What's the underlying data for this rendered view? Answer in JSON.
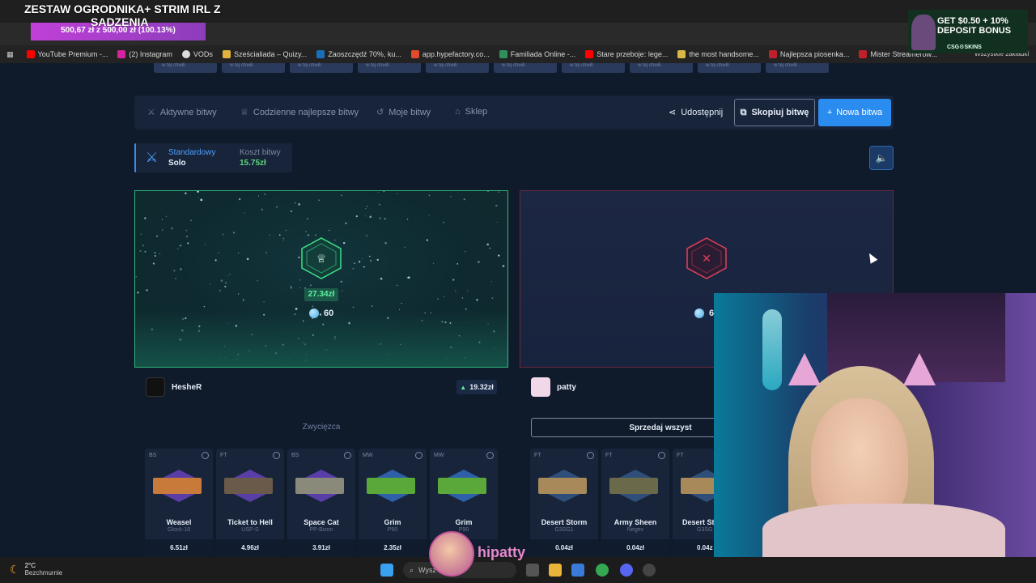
{
  "stream_overlay": {
    "title_line1": "ZESTAW OGRODNIKA+ STRIM IRL Z",
    "title_line2": "SADZENIA",
    "goal_text": "500,67 zł z 500,00 zł (100.13%)",
    "goal_progress_percent": 100
  },
  "browser": {
    "url": "19ab72-1b3c-4818-9262-5eedb91a6f1d",
    "bookmarks": [
      {
        "label": "YouTube Premium -...",
        "icon": "youtube-icon",
        "color": "#ff0000"
      },
      {
        "label": "(2) Instagram",
        "icon": "instagram-icon",
        "color": "#d6249f"
      },
      {
        "label": "VODs",
        "icon": "globe-icon",
        "color": "#dddddd"
      },
      {
        "label": "Sześcialiada – Quizy...",
        "icon": "quiz-icon",
        "color": "#e2b33c"
      },
      {
        "label": "Zaoszczędź 70%, ku...",
        "icon": "steam-icon",
        "color": "#1b6fb8"
      },
      {
        "label": "app.hypefactory.co...",
        "icon": "hype-icon",
        "color": "#e24a2c"
      },
      {
        "label": "Familiada Online -...",
        "icon": "familiada-icon",
        "color": "#2f8f5b"
      },
      {
        "label": "Stare przeboje: lege...",
        "icon": "youtube-icon",
        "color": "#ff0000"
      },
      {
        "label": "the most handsome...",
        "icon": "bookmark-icon",
        "color": "#d9b945"
      },
      {
        "label": "Najlepsza piosenka...",
        "icon": "u-icon",
        "color": "#c0202a"
      },
      {
        "label": "Mister Streamerów...",
        "icon": "u-icon",
        "color": "#c0202a"
      }
    ],
    "all_bookmarks_label": "Wszystkie zakładki"
  },
  "promo": {
    "text": "GET $0.50 + 10% DEPOSIT BONUS",
    "brand": "CSG⚙SKINS"
  },
  "top_strip_label": "w tej chwili",
  "nav": {
    "items": [
      {
        "label": "Aktywne bitwy",
        "icon": "swords-icon"
      },
      {
        "label": "Codzienne najlepsze bitwy",
        "icon": "trophy-icon"
      },
      {
        "label": "Moje bitwy",
        "icon": "history-icon"
      },
      {
        "label": "Sklep",
        "icon": "shop-icon"
      }
    ],
    "share_label": "Udostępnij",
    "copy_label": "Skopiuj bitwę",
    "new_label": "Nowa bitwa"
  },
  "battle_mode": {
    "type_label": "Standardowy",
    "mode_label": "Solo",
    "cost_label": "Koszt bitwy",
    "cost_value": "15.75zł"
  },
  "left_panel": {
    "win_value": "27.34zł",
    "tokens": "60"
  },
  "right_panel": {
    "tokens": "6"
  },
  "player_left": {
    "name": "HesheR",
    "earnings": "19.32zł",
    "status": "Zwycięzca"
  },
  "player_right": {
    "name": "patty",
    "sell_label": "Sprzedaj wszyst"
  },
  "left_items": [
    {
      "grade": "BS",
      "name": "Weasel",
      "type": "Glock-18",
      "price": "6.51zł",
      "hex_color": "#5a3ea8",
      "gun_color": "#c87a3a"
    },
    {
      "grade": "FT",
      "name": "Ticket to Hell",
      "type": "USP-S",
      "price": "4.96zł",
      "hex_color": "#5a3ea8",
      "gun_color": "#6a5a4a"
    },
    {
      "grade": "BS",
      "name": "Space Cat",
      "type": "PP-Bizon",
      "price": "3.91zł",
      "hex_color": "#5a3ea8",
      "gun_color": "#8a8a7a"
    },
    {
      "grade": "MW",
      "name": "Grim",
      "type": "P90",
      "price": "2.35zł",
      "hex_color": "#2f5fa8",
      "gun_color": "#5aa83a"
    },
    {
      "grade": "MW",
      "name": "Grim",
      "type": "P90",
      "price": "",
      "hex_color": "#2f5fa8",
      "gun_color": "#5aa83a"
    }
  ],
  "right_items": [
    {
      "grade": "FT",
      "name": "Desert Storm",
      "type": "G3SG1",
      "price": "0.04zł",
      "hex_color": "#2f4f7a",
      "gun_color": "#a88a5a"
    },
    {
      "grade": "FT",
      "name": "Army Sheen",
      "type": "Negev",
      "price": "0.04zł",
      "hex_color": "#2f4f7a",
      "gun_color": "#6a6a4a"
    },
    {
      "grade": "FT",
      "name": "Desert St",
      "type": "G3SG",
      "price": "0.04z",
      "hex_color": "#2f4f7a",
      "gun_color": "#a88a5a"
    }
  ],
  "streamer_tag": "hipatty",
  "taskbar": {
    "temperature": "2°C",
    "weather": "Bezchmurnie",
    "search_placeholder": "Wysz"
  }
}
